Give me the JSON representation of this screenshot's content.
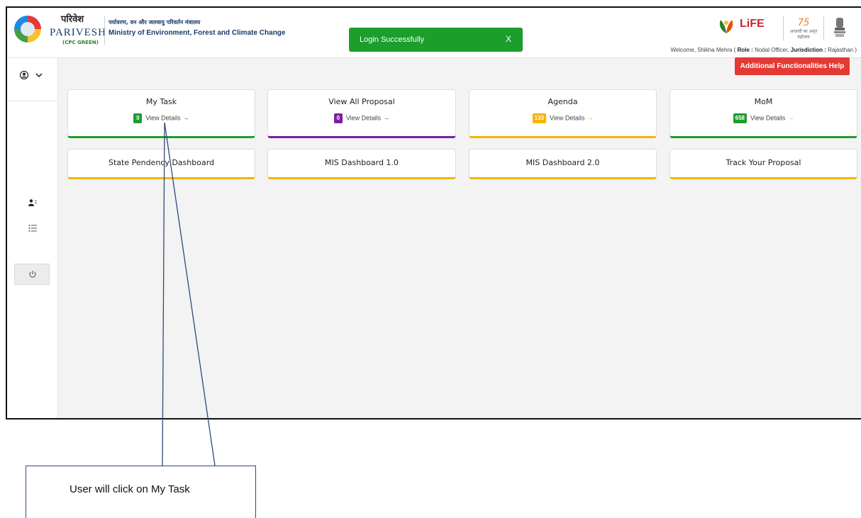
{
  "header": {
    "brand_hindi": "परिवेश",
    "brand_main": "PARIVESH",
    "brand_sub": "(CPC GREEN)",
    "ministry_hindi": "पर्यावरण, वन और जलवायु परिवर्तन मंत्रालय",
    "ministry_en": "Ministry of Environment, Forest and Climate Change",
    "life_logo": "LiFE",
    "azadi_text": "आज़ादी का अमृत महोत्सव",
    "azadi_number": "75",
    "welcome_prefix": "Welcome, Shikha Mehra ( ",
    "role_label": "Role :",
    "role_value": " Nodal Officer,",
    "jurisdiction_label": "Jurisdiction :",
    "jurisdiction_value": " Rajasthan )"
  },
  "toast": {
    "message": "Login Successfully",
    "close": "X"
  },
  "help_button": "Additional Functionalities Help",
  "cards_row1": [
    {
      "title": "My Task",
      "count": "0",
      "badge_color": "#1f9d2d",
      "detail": "View Details",
      "arrow": "→"
    },
    {
      "title": "View All Proposal",
      "count": "0",
      "badge_color": "#7b1fa2",
      "detail": "View Details",
      "arrow": "→"
    },
    {
      "title": "Agenda",
      "count": "133",
      "badge_color": "#f4b400",
      "detail": "View Details",
      "arrow": "→"
    },
    {
      "title": "MoM",
      "count": "658",
      "badge_color": "#1f9d2d",
      "detail": "View Details",
      "arrow": "→"
    }
  ],
  "cards_row2": [
    {
      "title": "State Pendency Dashboard"
    },
    {
      "title": "MIS Dashboard 1.0"
    },
    {
      "title": "MIS Dashboard 2.0"
    },
    {
      "title": "Track Your Proposal"
    }
  ],
  "annotation": {
    "text": "User will click on My Task"
  },
  "colors": {
    "green": "#1f9d2d",
    "purple": "#7b1fa2",
    "yellow": "#f4b400",
    "red": "#e53935"
  }
}
